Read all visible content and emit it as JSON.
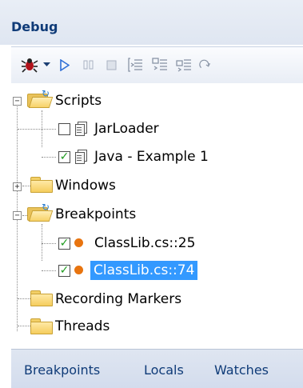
{
  "panel": {
    "title": "Debug"
  },
  "toolbar": {
    "buttons": [
      {
        "icon": "bug-icon"
      },
      {
        "icon": "dropdown-arrow-icon"
      },
      {
        "icon": "play-icon"
      },
      {
        "icon": "pause-icon"
      },
      {
        "icon": "stop-icon"
      },
      {
        "icon": "step-into-icon"
      },
      {
        "icon": "step-over-icon"
      },
      {
        "icon": "step-out-icon"
      },
      {
        "icon": "run-to-cursor-icon"
      }
    ]
  },
  "tree": {
    "scripts": {
      "label": "Scripts",
      "children": [
        {
          "label": "JarLoader",
          "checked": false
        },
        {
          "label": "Java - Example 1",
          "checked": true
        }
      ]
    },
    "windows": {
      "label": "Windows"
    },
    "breakpoints": {
      "label": "Breakpoints",
      "children": [
        {
          "label": "ClassLib.cs::25",
          "checked": true,
          "selected": false
        },
        {
          "label": "ClassLib.cs::74",
          "checked": true,
          "selected": true
        }
      ]
    },
    "recording_markers": {
      "label": "Recording Markers"
    },
    "threads": {
      "label": "Threads"
    }
  },
  "tabs": [
    {
      "label": "Breakpoints"
    },
    {
      "label": "Locals"
    },
    {
      "label": "Watches"
    }
  ],
  "colors": {
    "title_text": "#0f3b78",
    "selection": "#3399ff",
    "breakpoint": "#e8740f",
    "check": "#1e9b1e"
  }
}
